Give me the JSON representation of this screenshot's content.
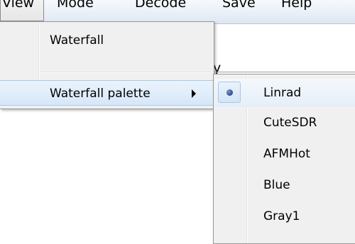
{
  "menubar": {
    "items": [
      {
        "label": "View"
      },
      {
        "label": "Mode"
      },
      {
        "label": "Decode"
      },
      {
        "label": "Save"
      },
      {
        "label": "Help"
      }
    ]
  },
  "background": {
    "partial_text": "y"
  },
  "view_menu": {
    "items": [
      {
        "label": "Waterfall"
      },
      {
        "label": "Waterfall palette"
      }
    ]
  },
  "palette_submenu": {
    "selected": "Linrad",
    "items": [
      {
        "label": "Linrad"
      },
      {
        "label": "CuteSDR"
      },
      {
        "label": "AFMHot"
      },
      {
        "label": "Blue"
      },
      {
        "label": "Gray1"
      }
    ]
  },
  "icons": {
    "submenu_arrow": "chevron-right-icon",
    "radio_selected": "radio-dot-icon"
  }
}
